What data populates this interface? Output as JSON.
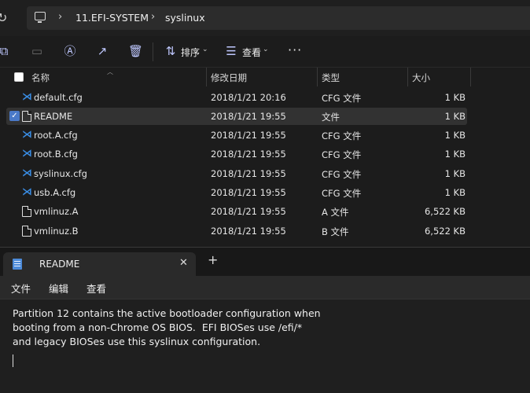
{
  "breadcrumb": {
    "items": [
      "11.EFI-SYSTEM",
      "syslinux"
    ]
  },
  "toolbar": {
    "sort_label": "排序",
    "view_label": "查看"
  },
  "columns": {
    "name": "名称",
    "date": "修改日期",
    "type": "类型",
    "size": "大小"
  },
  "files": [
    {
      "name": "default.cfg",
      "date": "2018/1/21 20:16",
      "type": "CFG 文件",
      "size": "1 KB",
      "icon": "vscode-file-icon",
      "selected": false
    },
    {
      "name": "README",
      "date": "2018/1/21 19:55",
      "type": "文件",
      "size": "1 KB",
      "icon": "document-icon",
      "selected": true
    },
    {
      "name": "root.A.cfg",
      "date": "2018/1/21 19:55",
      "type": "CFG 文件",
      "size": "1 KB",
      "icon": "vscode-file-icon",
      "selected": false
    },
    {
      "name": "root.B.cfg",
      "date": "2018/1/21 19:55",
      "type": "CFG 文件",
      "size": "1 KB",
      "icon": "vscode-file-icon",
      "selected": false
    },
    {
      "name": "syslinux.cfg",
      "date": "2018/1/21 19:55",
      "type": "CFG 文件",
      "size": "1 KB",
      "icon": "vscode-file-icon",
      "selected": false
    },
    {
      "name": "usb.A.cfg",
      "date": "2018/1/21 19:55",
      "type": "CFG 文件",
      "size": "1 KB",
      "icon": "vscode-file-icon",
      "selected": false
    },
    {
      "name": "vmlinuz.A",
      "date": "2018/1/21 19:55",
      "type": "A 文件",
      "size": "6,522 KB",
      "icon": "document-icon",
      "selected": false
    },
    {
      "name": "vmlinuz.B",
      "date": "2018/1/21 19:55",
      "type": "B 文件",
      "size": "6,522 KB",
      "icon": "document-icon",
      "selected": false
    }
  ],
  "notepad": {
    "tab_title": "README",
    "menu": [
      "文件",
      "编辑",
      "查看"
    ],
    "lines": [
      "Partition 12 contains the active bootloader configuration when",
      "booting from a non-Chrome OS BIOS.  EFI BIOSes use /efi/*",
      "and legacy BIOSes use this syslinux configuration."
    ]
  },
  "colors": {
    "accent": "#4a79c8",
    "vscode_blue": "#3a8ee6",
    "icon_tint": "#bfc8ff"
  }
}
